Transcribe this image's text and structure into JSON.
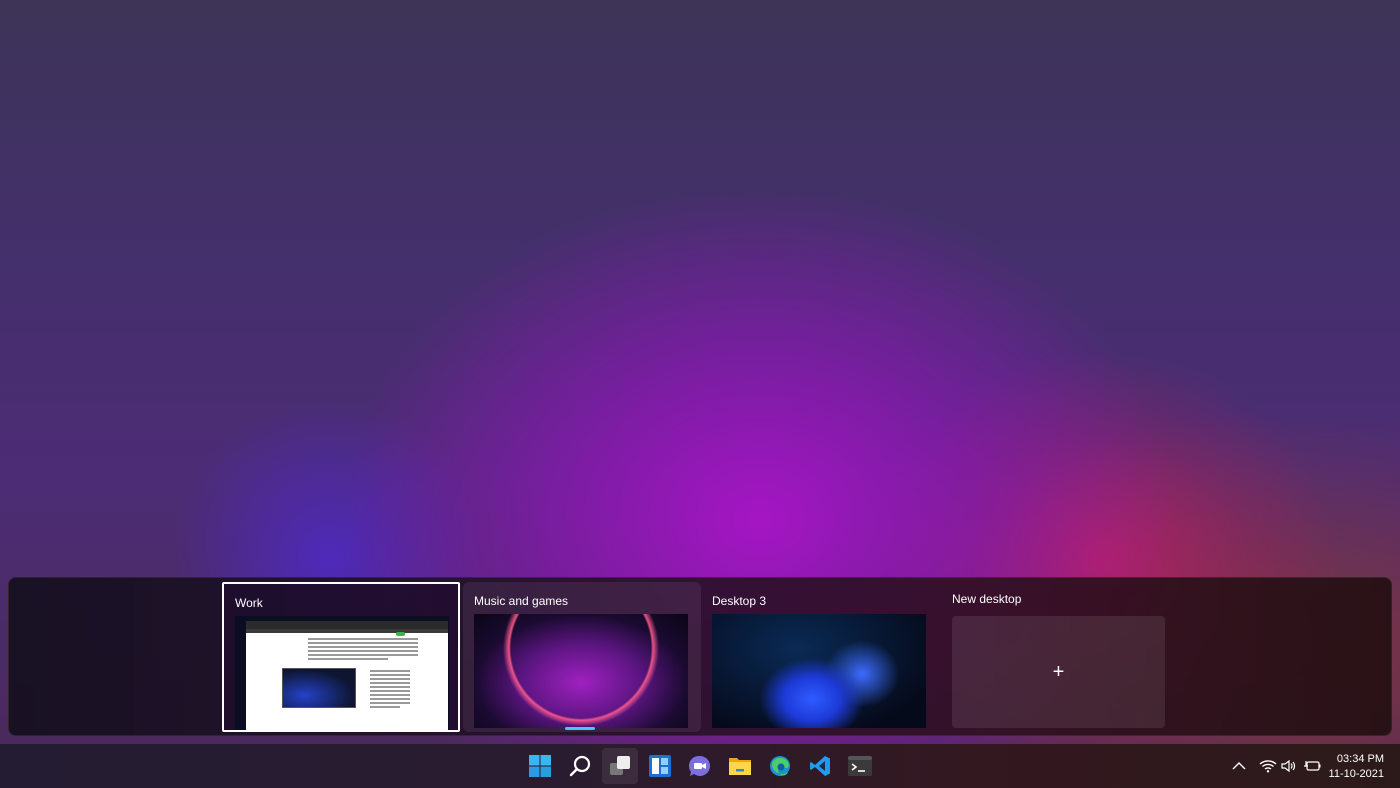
{
  "desktops": [
    {
      "label": "Work",
      "state": "active",
      "thumbnail": "browser-window"
    },
    {
      "label": "Music and games",
      "state": "hover",
      "thumbnail": "wallpaper-bloom-purple"
    },
    {
      "label": "Desktop 3",
      "state": "normal",
      "thumbnail": "wallpaper-bloom-blue"
    }
  ],
  "new_desktop": {
    "label": "New desktop",
    "icon": "plus-icon",
    "glyph": "+"
  },
  "taskbar": {
    "apps": [
      {
        "name": "start",
        "icon": "windows-logo-icon"
      },
      {
        "name": "search",
        "icon": "search-icon"
      },
      {
        "name": "task-view",
        "icon": "task-view-icon",
        "active": true
      },
      {
        "name": "widgets",
        "icon": "widgets-icon"
      },
      {
        "name": "teams-chat",
        "icon": "teams-chat-icon"
      },
      {
        "name": "file-explorer",
        "icon": "folder-icon"
      },
      {
        "name": "edge",
        "icon": "edge-icon"
      },
      {
        "name": "vscode",
        "icon": "vscode-icon"
      },
      {
        "name": "terminal",
        "icon": "terminal-icon"
      }
    ],
    "tray": {
      "overflow_icon": "chevron-up-icon",
      "wifi_icon": "wifi-icon",
      "volume_icon": "volume-icon",
      "battery_icon": "battery-charging-icon",
      "time": "03:34 PM",
      "date": "11-10-2021"
    }
  },
  "colors": {
    "accent": "#4cc2ff",
    "active_border": "#ffffff"
  }
}
